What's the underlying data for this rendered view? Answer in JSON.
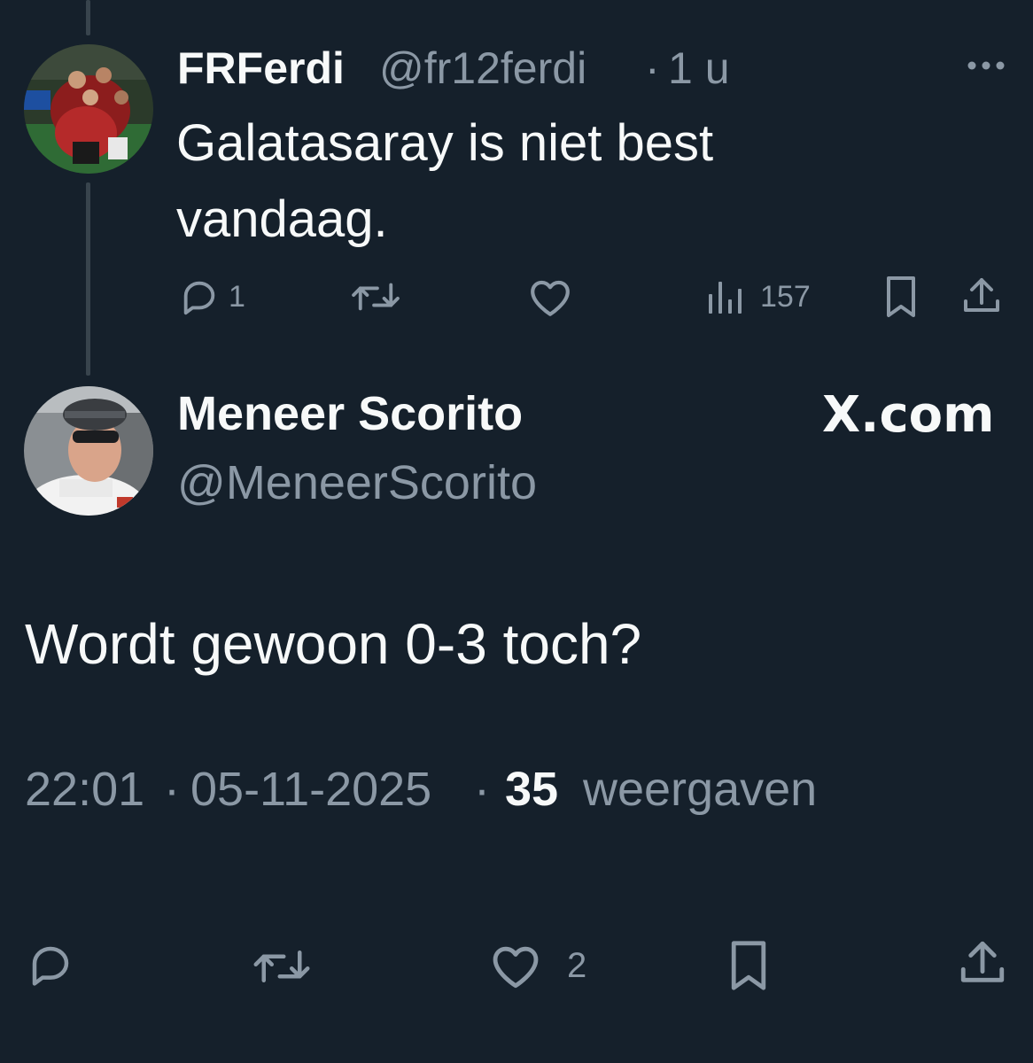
{
  "parent_tweet": {
    "display_name": "FRFerdi",
    "handle": "@fr12ferdi",
    "separator": "·",
    "time": "1 u",
    "text_line1": "Galatasaray is niet best",
    "text_line2": "vandaag.",
    "reply_count": "1",
    "views_count": "157",
    "avatar_icon": "football-celebration-photo"
  },
  "main_tweet": {
    "display_name": "Meneer Scorito",
    "handle": "@MeneerScorito",
    "brand": "X.com",
    "text": "Wordt gewoon 0-3 toch?",
    "time": "22:01",
    "date": "05-11-2025",
    "separator": "·",
    "views_count": "35",
    "views_label": "weergaven",
    "like_count": "2",
    "avatar_icon": "cyclist-selfie-photo"
  },
  "colors": {
    "background": "#15202b",
    "muted_text": "#8b98a5",
    "thread_line": "#38444d",
    "text": "#f7f9f9"
  }
}
